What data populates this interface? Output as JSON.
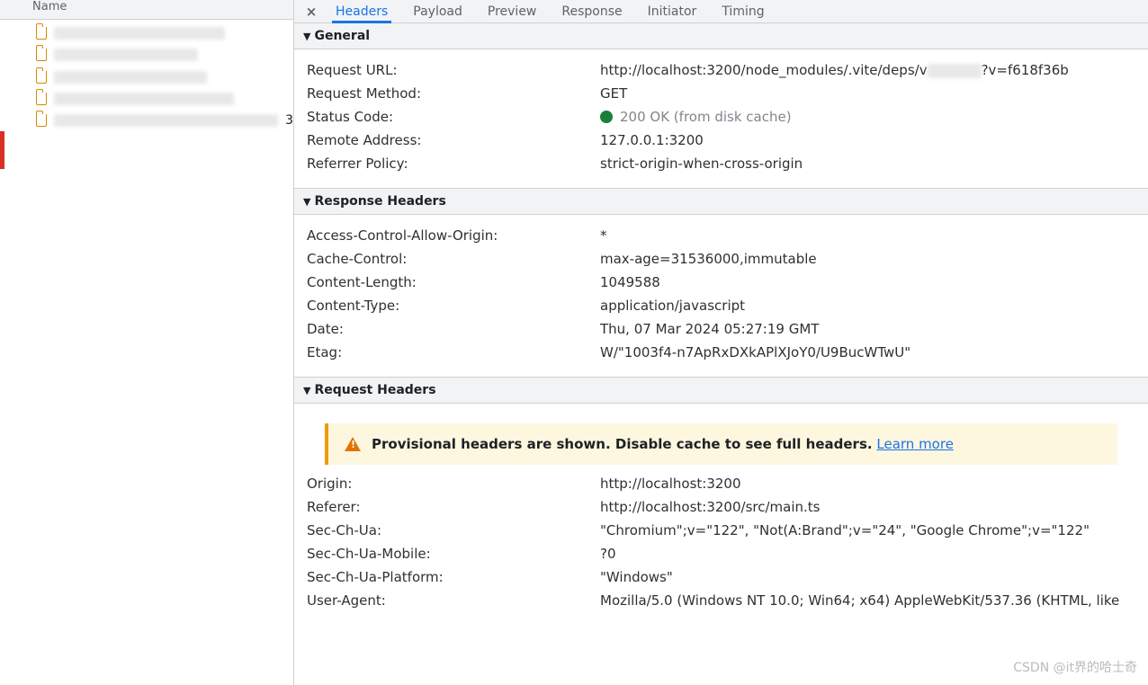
{
  "left": {
    "column_header": "Name",
    "rows_placeholder": "____"
  },
  "tabs": {
    "close": "×",
    "items": [
      "Headers",
      "Payload",
      "Preview",
      "Response",
      "Initiator",
      "Timing"
    ],
    "activeIndex": 0
  },
  "sections": {
    "general": {
      "title": "General",
      "rows": [
        {
          "key": "Request URL:",
          "val_pre": "http://localhost:3200/node_modules/.vite/deps/v",
          "val_post": "?v=f618f36b",
          "has_blur": true
        },
        {
          "key": "Request Method:",
          "val": "GET"
        },
        {
          "key": "Status Code:",
          "status": "200 OK (from disk cache)"
        },
        {
          "key": "Remote Address:",
          "val": "127.0.0.1:3200"
        },
        {
          "key": "Referrer Policy:",
          "val": "strict-origin-when-cross-origin"
        }
      ]
    },
    "response": {
      "title": "Response Headers",
      "rows": [
        {
          "key": "Access-Control-Allow-Origin:",
          "val": "*"
        },
        {
          "key": "Cache-Control:",
          "val": "max-age=31536000,immutable"
        },
        {
          "key": "Content-Length:",
          "val": "1049588"
        },
        {
          "key": "Content-Type:",
          "val": "application/javascript"
        },
        {
          "key": "Date:",
          "val": "Thu, 07 Mar 2024 05:27:19 GMT"
        },
        {
          "key": "Etag:",
          "val": "W/\"1003f4-n7ApRxDXkAPlXJoY0/U9BucWTwU\""
        }
      ]
    },
    "request": {
      "title": "Request Headers",
      "banner": {
        "bold": "Provisional headers are shown. Disable cache to see full headers.",
        "link": "Learn more"
      },
      "rows": [
        {
          "key": "Origin:",
          "val": "http://localhost:3200"
        },
        {
          "key": "Referer:",
          "val": "http://localhost:3200/src/main.ts"
        },
        {
          "key": "Sec-Ch-Ua:",
          "val": "\"Chromium\";v=\"122\", \"Not(A:Brand\";v=\"24\", \"Google Chrome\";v=\"122\""
        },
        {
          "key": "Sec-Ch-Ua-Mobile:",
          "val": "?0"
        },
        {
          "key": "Sec-Ch-Ua-Platform:",
          "val": "\"Windows\""
        },
        {
          "key": "User-Agent:",
          "val": "Mozilla/5.0 (Windows NT 10.0; Win64; x64) AppleWebKit/537.36 (KHTML, like"
        }
      ]
    }
  },
  "watermark": "CSDN @it界的哈士奇"
}
